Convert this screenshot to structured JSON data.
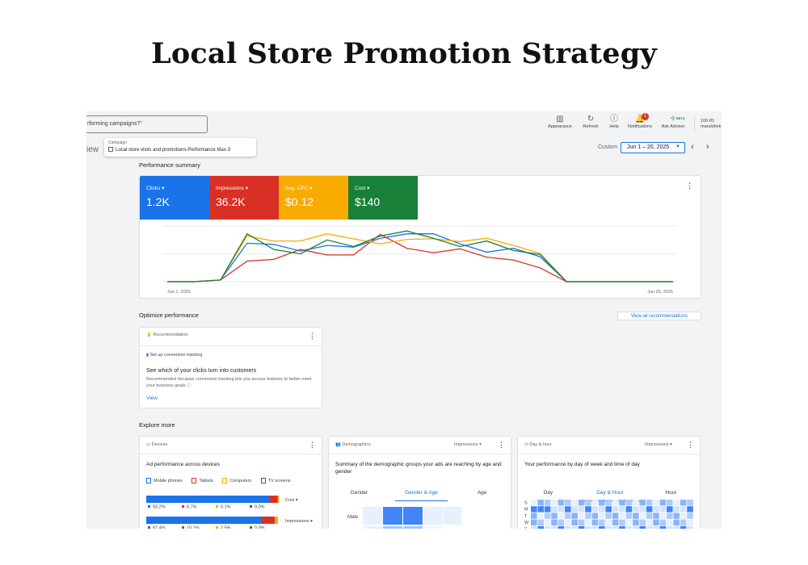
{
  "page_title": "Local Store Promotion Strategy",
  "topbar": {
    "search_text": "rforming campaigns?\"",
    "tools": [
      {
        "label": "Appearance",
        "icon": "appearance-icon"
      },
      {
        "label": "Refresh",
        "icon": "refresh-icon"
      },
      {
        "label": "Help",
        "icon": "help-icon"
      },
      {
        "label": "Notifications",
        "icon": "bell-icon",
        "badge": "1"
      },
      {
        "label": "Ask Advisor",
        "icon": "sparkle-icon",
        "badge": "BETA"
      }
    ],
    "account_line1": "100-81",
    "account_line2": "marulshek"
  },
  "header": {
    "view_label": "iew",
    "campaign_label": "Campaign",
    "campaign_value": "Local store visits and promotions-Performance Max-3",
    "date_custom": "Custom",
    "date_range": "Jun 1 – 20, 2025"
  },
  "performance": {
    "section_title": "Performance summary",
    "metrics": [
      {
        "label": "Clicks ▾",
        "value": "1.2K",
        "color": "#1a73e8"
      },
      {
        "label": "Impressions ▾",
        "value": "36.2K",
        "color": "#d93025"
      },
      {
        "label": "Avg. CPC ▾",
        "value": "$0.12",
        "color": "#f9ab00"
      },
      {
        "label": "Cost ▾",
        "value": "$140",
        "color": "#188038"
      }
    ],
    "x_start": "Jun 1, 2025",
    "x_end": "Jun 20, 2025"
  },
  "chart_data": {
    "type": "line",
    "x": [
      "Jun 1, 2025",
      "Jun 2",
      "Jun 3",
      "Jun 4",
      "Jun 5",
      "Jun 6",
      "Jun 7",
      "Jun 8",
      "Jun 9",
      "Jun 10",
      "Jun 11",
      "Jun 12",
      "Jun 13",
      "Jun 14",
      "Jun 15",
      "Jun 16",
      "Jun 17",
      "Jun 18",
      "Jun 19",
      "Jun 20, 2025"
    ],
    "series": [
      {
        "color": "#1a73e8",
        "values": [
          0,
          0,
          3,
          69,
          67,
          55,
          65,
          62,
          78,
          86,
          86,
          68,
          53,
          60,
          45,
          0,
          0,
          0,
          0,
          0
        ]
      },
      {
        "color": "#d93025",
        "values": [
          0,
          0,
          3,
          37,
          40,
          58,
          48,
          48,
          85,
          60,
          52,
          59,
          44,
          39,
          25,
          0,
          0,
          0,
          0,
          0
        ]
      },
      {
        "color": "#f9ab00",
        "values": [
          0,
          0,
          3,
          82,
          73,
          73,
          86,
          77,
          68,
          76,
          77,
          72,
          78,
          65,
          51,
          0,
          0,
          0,
          0,
          0
        ]
      },
      {
        "color": "#188038",
        "values": [
          0,
          0,
          3,
          86,
          58,
          50,
          75,
          63,
          82,
          91,
          78,
          63,
          73,
          56,
          49,
          0,
          0,
          0,
          0,
          0
        ]
      }
    ],
    "ylim": [
      0,
      100
    ],
    "grid": true
  },
  "optimize": {
    "section_title": "Optimize performance",
    "view_all": "View all recommendations",
    "card_header": "Recommendation",
    "item": "Set up conversion tracking",
    "title": "See which of your clicks turn into customers",
    "desc": "Recommended because conversion tracking lets you access features to better meet your business goals",
    "view": "View"
  },
  "explore": {
    "section_title": "Explore more",
    "devices": {
      "header": "Devices",
      "title": "Ad performance across devices",
      "legend": [
        "Mobile phones",
        "Tablets",
        "Computers",
        "TV screens"
      ],
      "legend_colors": [
        "#1a73e8",
        "#d93025",
        "#f9ab00",
        "#188038"
      ],
      "cost_label": "Cost ▾",
      "cost_shares": [
        93.2,
        6.7,
        0.1,
        0.0
      ],
      "cost_shares_text": [
        "93.2%",
        "6.7%",
        "0.1%",
        "0.0%"
      ],
      "impressions_label": "Impressions ▾",
      "impressions_shares": [
        87.4,
        10.1,
        2.5,
        0.0
      ],
      "impressions_shares_text": [
        "87.4%",
        "10.1%",
        "2.5%",
        "0.0%"
      ]
    },
    "demographics": {
      "header": "Demographics",
      "dropdown": "Impressions ▾",
      "title": "Summary of the demographic groups your ads are reaching by age and gender",
      "tabs": [
        "Gender",
        "Gender & Age",
        "Age"
      ],
      "row_label": "Male"
    },
    "dayhour": {
      "header": "Day & hour",
      "dropdown": "Impressions ▾",
      "title": "Your performance by day of week and time of day",
      "tabs": [
        "Day",
        "Day & Hour",
        "Hour"
      ],
      "days": [
        "S",
        "M",
        "T",
        "W",
        "T"
      ]
    }
  }
}
